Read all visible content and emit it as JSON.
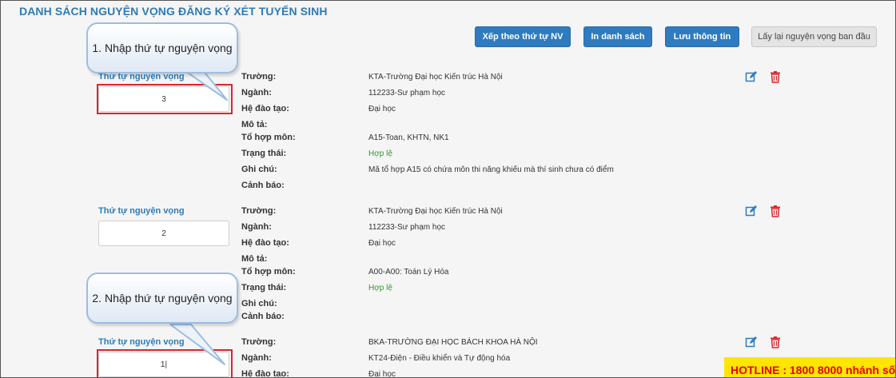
{
  "page_title": "DANH SÁCH NGUYỆN VỌNG ĐĂNG KÝ XÉT TUYỂN SINH",
  "buttons": {
    "sort": "Xếp theo thứ tự NV",
    "print": "In danh sách",
    "save": "Lưu thông tin",
    "reset": "Lấy lại nguyện vọng ban đầu"
  },
  "field_labels": {
    "school": "Trường:",
    "major": "Ngành:",
    "training": "Hệ đào tạo:",
    "desc": "Mô tả:",
    "combo": "Tổ hợp môn:",
    "status": "Trạng thái:",
    "note": "Ghi chú:",
    "warning": "Cảnh báo:"
  },
  "order_label": "Thứ tự nguyện vọng",
  "wishes": [
    {
      "order": "3",
      "school": "KTA-Trường Đại học Kiến trúc Hà Nội",
      "major": "112233-Sư phạm học",
      "training": "Đại học",
      "desc": "",
      "combo": "A15-Toan, KHTN, NK1",
      "status": "Hợp lệ",
      "note": "Mã tổ hợp A15 có chứa môn thi năng khiếu mà thí sinh chưa có điểm",
      "warning": ""
    },
    {
      "order": "2",
      "school": "KTA-Trường Đại học Kiến trúc Hà Nội",
      "major": "112233-Sư phạm học",
      "training": "Đại học",
      "desc": "",
      "combo": "A00-A00: Toán Lý Hóa",
      "status": "Hợp lệ",
      "note": "",
      "warning": ""
    },
    {
      "order": "1|",
      "school": "BKA-TRƯỜNG ĐẠI HỌC BÁCH KHOA HÀ NỘI",
      "major": "KT24-Điện - Điều khiển và Tự động hóa",
      "training": "Đại học"
    }
  ],
  "callouts": {
    "first": "1. Nhập thứ tự nguyện vọng",
    "second": "2. Nhập thứ tự nguyện vọng"
  },
  "hotline": "HOTLINE : 1800 8000 nhánh số",
  "icons": {
    "edit": "edit-icon",
    "delete": "trash-icon"
  },
  "colors": {
    "accent": "#2f7bb5",
    "button": "#2f7bc0",
    "valid": "#2a9a2a",
    "highlight": "#d9262b",
    "hotline_bg": "#ffe600",
    "hotline_text": "#e60000"
  }
}
